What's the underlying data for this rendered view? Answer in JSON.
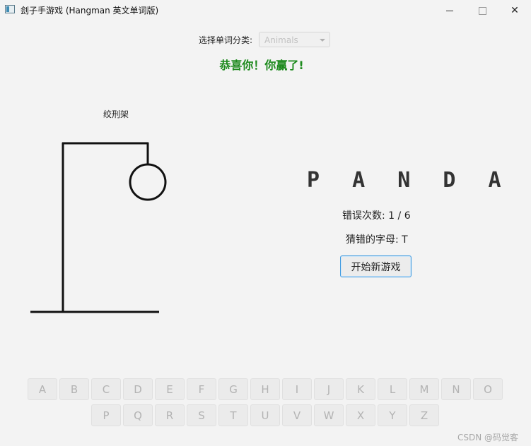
{
  "window": {
    "title": "刽子手游戏 (Hangman 英文单词版)",
    "controls": {
      "minimize": "—",
      "maximize": "☐",
      "close": "✕"
    }
  },
  "category": {
    "label": "选择单词分类:",
    "selected": "Animals"
  },
  "status": {
    "message": "恭喜你！你赢了!",
    "color": "#1d8a1d"
  },
  "gallows": {
    "label": "绞刑架",
    "wrong_guesses": 1,
    "max_wrong": 6
  },
  "game": {
    "word_display": "P A N D A",
    "wrong_count_text": "错误次数: 1 / 6",
    "wrong_letters_text": "猜错的字母: T",
    "new_game_label": "开始新游戏"
  },
  "keyboard": {
    "row1": [
      "A",
      "B",
      "C",
      "D",
      "E",
      "F",
      "G",
      "H",
      "I",
      "J",
      "K",
      "L",
      "M",
      "N",
      "O"
    ],
    "row2": [
      "P",
      "Q",
      "R",
      "S",
      "T",
      "U",
      "V",
      "W",
      "X",
      "Y",
      "Z"
    ],
    "enabled": false
  },
  "watermark": "CSDN @码觉客"
}
